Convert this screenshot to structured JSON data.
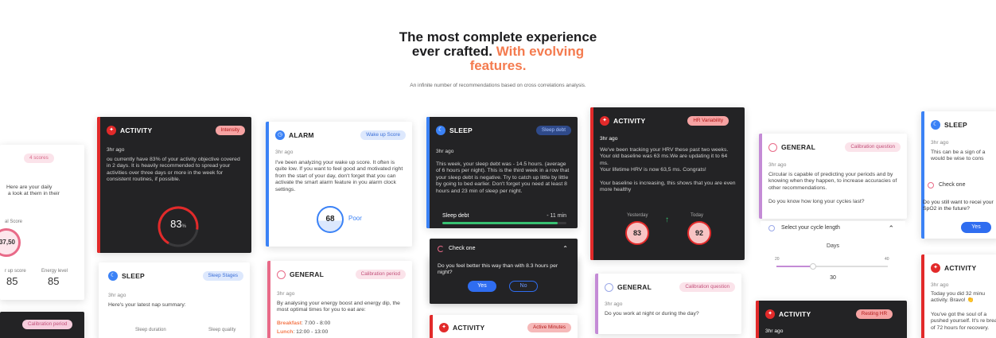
{
  "hero": {
    "title_line1": "The most complete experience",
    "title_line2_a": "ever crafted.",
    "title_line2_b": "With evolving",
    "title_line3": "features.",
    "subtitle": "An infinite number of recommendations based on cross correlations analysis."
  },
  "colors": {
    "accent": "#f47b4f",
    "red": "#e22a2a",
    "blue": "#3b82f6",
    "pink": "#e86a88"
  },
  "card_scores": {
    "pill": "4 scores",
    "body": "Here are your daily\n a look at them in their",
    "score_label": "al Score",
    "score_value": "37,50",
    "col1_label": "r up score",
    "col2_label": "Energy level",
    "col1_value": "85",
    "col2_value": "85"
  },
  "card_calib_bottom": {
    "pill": "Calibration period"
  },
  "card_activity1": {
    "title": "ACTIVITY",
    "pill": "Intensity",
    "ago": "3hr ago",
    "body": "ou currently have 83% of your activity objective covered in 2 days. It is heavily recommended to spread your activities over three days or more in the week for consistent routines, if possible.",
    "gauge_value": "83",
    "gauge_unit": "%",
    "gauge_fraction": 0.83
  },
  "card_sleep_stages": {
    "title": "SLEEP",
    "pill": "Sleep Stages",
    "ago": "3hr ago",
    "body": "Here's your latest nap summary:",
    "col1": "Sleep duration",
    "col2": "Sleep quality"
  },
  "card_alarm": {
    "title": "ALARM",
    "pill": "Wake up Score",
    "ago": "3hr ago",
    "body": "I've been analyzing your wake up score. It often is quite low. If you want to feel good and motivated right from the start of your day, don't forget that you can activate the smart alarm feature in you alarm clock settings.",
    "score": "68",
    "rating": "Poor"
  },
  "card_general_calib": {
    "title": "GENERAL",
    "pill": "Calibration period",
    "ago": "3hr ago",
    "body": "By analysing your energy boost and energy dip, the most optimal times for you to eat are:",
    "row1_label": "Breakfast",
    "row1_value": ": 7:00 - 8:00",
    "row2_label": "Lunch",
    "row2_value": ": 12:00 - 13:00"
  },
  "card_sleep_debt": {
    "title": "SLEEP",
    "pill": "Sleep debt",
    "ago": "3hr ago",
    "body": "This week, your sleep debt was - 14.5 hours. (average of 6 hours per night). This is the third week in a row that your sleep debt is negative. Try to catch up little by little by going to bed earlier. Don't forget you need at least 8 hours and 23 min of sleep per night.",
    "bar_label": "Sleep debt",
    "bar_value": "- 11 min",
    "bar_fraction": 0.93
  },
  "card_check_one": {
    "title": "Check one",
    "question": "Do you feel better this way than with 8.3 hours per night?",
    "yes": "Yes",
    "no": "No"
  },
  "card_activity_minutes": {
    "title": "ACTIVITY",
    "pill": "Active Minutes"
  },
  "card_hrv": {
    "title": "ACTIVITY",
    "pill": "HR Variability",
    "ago": "3hr ago",
    "body1": "We've been tracking your HRV these past two weeks. Your old baseline was 63 ms.We are updating it to 64 ms.",
    "body2": "Your lifetime HRV is now 63,5 ms. Congrats!",
    "body3": "Your baseline is increasing, this shows that you are even more healthy",
    "yesterday_label": "Yesterday",
    "today_label": "Today",
    "yesterday_value": "83",
    "today_value": "92"
  },
  "card_general_night": {
    "title": "GENERAL",
    "pill": "Calibration question",
    "ago": "3hr ago",
    "body": "Do you work at night or during the day?"
  },
  "card_general_cycle": {
    "title": "GENERAL",
    "pill": "Calibration question",
    "ago": "3hr ago",
    "body": "Circular is capable of predicting your periods and by knowing when they happen, to increase accuracies of other recommendations.",
    "question": "Do you know how long your cycles last?",
    "select_label": "Select your cycle length",
    "unit": "Days",
    "min_label": "20",
    "max_label": "40",
    "value": "30",
    "slider_fraction": 0.33
  },
  "card_resting_hr": {
    "title": "ACTIVITY",
    "pill": "Resting HR",
    "ago": "3hr ago"
  },
  "card_sleep_right": {
    "title": "SLEEP",
    "ago": "3hr ago",
    "body": "This can be a sign of a would be wise to cons",
    "check": "Check one",
    "question": "Do you still want to recei your SpO2 in the future?",
    "yes": "Yes"
  },
  "card_activity_right": {
    "title": "ACTIVITY",
    "ago": "3hr ago",
    "body1": "Today you did 32 minu activity. Bravo! 👏",
    "body2": "You've got the soul of a pushed yourself. It's re break of 72 hours for recovery."
  }
}
